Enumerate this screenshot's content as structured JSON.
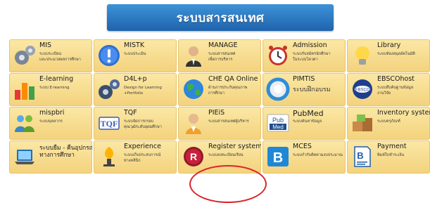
{
  "header": {
    "title": "ระบบสารสนเทศ"
  },
  "tiles": [
    {
      "title": "MIS",
      "sub": "ระบบระเบียน\nและประมวลผลการศึกษา",
      "icon": "gears-icon"
    },
    {
      "title": "MISTK",
      "sub": "ระบบประเมิน",
      "icon": "exclamation-icon"
    },
    {
      "title": "MANAGE",
      "sub": "ระบบสารสนเทศ\nเพื่อการบริหาร",
      "icon": "person-icon"
    },
    {
      "title": "Admission",
      "sub": "ระบบรับสมัครนักศึกษา\nในระบบโควตา",
      "icon": "alarm-clock-icon"
    },
    {
      "title": "Library",
      "sub": "ระบบห้องสมุดอัตโนมัติ",
      "icon": "lightbulb-icon"
    },
    {
      "title": "E-learning",
      "sub": "ระบบ E-learning",
      "icon": "bar-chart-icon"
    },
    {
      "title": "D4L+p",
      "sub": "Design for Learning\n+Portfolio",
      "icon": "gears-icon"
    },
    {
      "title": "CHE QA Online",
      "sub": "ด้านการประกันคุณภาพ\nการศึกษา",
      "icon": "globe-icon"
    },
    {
      "title": "PIMTIS",
      "sub": "ระบบฝึกอบรม",
      "icon": "life-ring-icon"
    },
    {
      "title": "EBSCOhost",
      "sub": "ระบบสืบค้นฐานข้อมูล\nงานวิจัย",
      "icon": "ebsco-icon"
    },
    {
      "title": "mispbri",
      "sub": "ระบบบุคลากร",
      "icon": "people-icon"
    },
    {
      "title": "TQF",
      "sub": "ระบบจัดการกรอบ\nคุณวุฒิระดับอุดมศึกษา",
      "icon": "tqf-icon"
    },
    {
      "title": "PIEiS",
      "sub": "ระบบสารสนเทศผู้บริหาร",
      "icon": "person-icon"
    },
    {
      "title": "PubMed",
      "sub": "ระบบค้นหาข้อมูล",
      "icon": "pubmed-icon"
    },
    {
      "title": "Inventory system",
      "sub": "ระบบครุภัณฑ์",
      "icon": "boxes-icon"
    },
    {
      "title": "ระบบยืม - คืนอุปกรณ์\nทางการศึกษา",
      "sub": "",
      "icon": "laptop-icon"
    },
    {
      "title": "Experience",
      "sub": "ระบบเก็บประสบการณ์\nทางคลินิก",
      "icon": "lamp-icon"
    },
    {
      "title": "Register system",
      "sub": "ระบบลงทะเบียนเรียน",
      "icon": "register-icon"
    },
    {
      "title": "MCES",
      "sub": "ระบบกำกับติดตามงบประมาณ",
      "icon": "bitcoin-icon"
    },
    {
      "title": "Payment",
      "sub": "พิมพ์ใบชำระเงิน",
      "icon": "bill-icon"
    }
  ],
  "colors": {
    "banner": "#2a78c4",
    "tile": "#f6da8a",
    "highlight": "#d9262b"
  }
}
